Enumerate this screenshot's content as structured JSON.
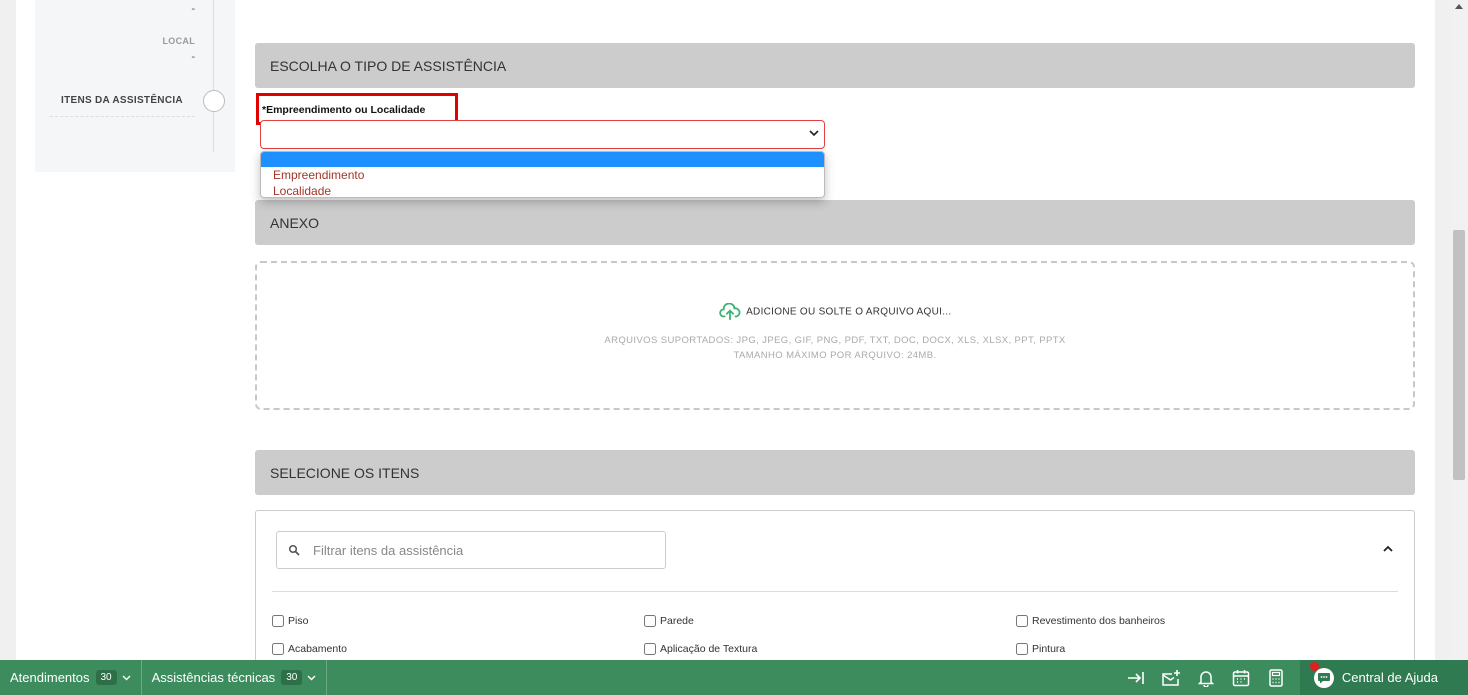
{
  "sidebar": {
    "dash_top": "-",
    "local_label": "LOCAL",
    "local_value": "-",
    "current_item": "ITENS DA ASSISTÊNCIA"
  },
  "tipo_section": {
    "title": "ESCOLHA O TIPO DE ASSISTÊNCIA",
    "field_label": "*Empreendimento ou Localidade",
    "selected_value": "",
    "options": [
      "Empreendimento",
      "Localidade"
    ]
  },
  "anexo_section": {
    "title": "ANEXO",
    "drop_text": "ADICIONE OU SOLTE O ARQUIVO AQUI...",
    "supported": "ARQUIVOS SUPORTADOS: JPG, JPEG, GIF, PNG, PDF, TXT, DOC, DOCX, XLS, XLSX, PPT, PPTX",
    "max_size": "TAMANHO MÁXIMO POR ARQUIVO: 24MB."
  },
  "itens_section": {
    "title": "SELECIONE OS ITENS",
    "filter_placeholder": "Filtrar itens da assistência",
    "items": [
      "Piso",
      "Parede",
      "Revestimento dos banheiros",
      "Acabamento",
      "Aplicação de Textura",
      "Pintura"
    ]
  },
  "bottombar": {
    "tabs": [
      {
        "label": "Atendimentos",
        "count": "30"
      },
      {
        "label": "Assistências técnicas",
        "count": "30"
      }
    ],
    "help_label": "Central de Ajuda",
    "icons": [
      "collapse-right-icon",
      "mail-add-icon",
      "bell-icon",
      "calendar-icon",
      "calculator-icon",
      "chat-help-icon"
    ]
  },
  "colors": {
    "bottombar": "#3c8c5e",
    "section_header": "#cccccc",
    "required_highlight": "#e00000",
    "option_highlight": "#1e90ff",
    "option_text": "#a0372a",
    "upload_icon": "#3cb371"
  }
}
